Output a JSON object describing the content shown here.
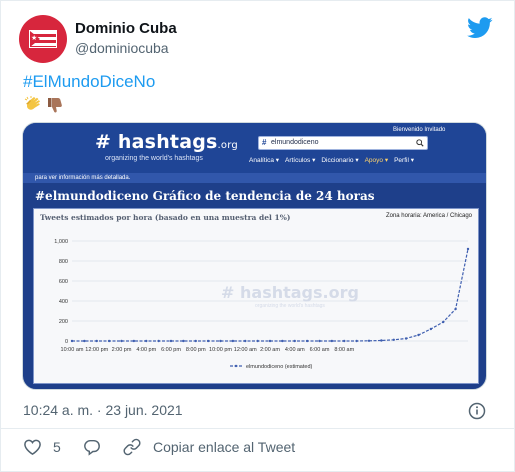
{
  "author": {
    "name": "Dominio Cuba",
    "handle": "@dominiocuba"
  },
  "tweet": {
    "hashtag": "#ElMundoDiceNo",
    "emojis": [
      "clapping-hands-emoji",
      "thumbs-down-emoji"
    ],
    "timestamp": "10:24 a. m. · 23 jun. 2021",
    "like_count": "5",
    "copy_link_label": "Copiar enlace al Tweet"
  },
  "media": {
    "site_logo": "# hashtags",
    "site_logo_suffix": ".org",
    "site_slogan": "organizing the world's hashtags",
    "welcome": "Bienvenido Invitado",
    "search_value": "elmundodiceno",
    "nav": [
      "Analítica ▾",
      "Artículos ▾",
      "Diccionario ▾",
      "Apoyo ▾",
      "Perfil ▾"
    ],
    "info_bar": "para ver información más detallada.",
    "chart_title": "#elmundodiceno Gráfico de tendencia de 24 horas",
    "chart_subtitle": "Tweets estimados por hora (basado en una muestra del 1%)",
    "timezone": "Zona horaria: America / Chicago",
    "watermark": "# hashtags.org",
    "watermark_slogan": "organizing the world's hashtags"
  },
  "chart_data": {
    "type": "line",
    "title": "#elmundodiceno Gráfico de tendencia de 24 horas",
    "subtitle": "Tweets estimados por hora (basado en una muestra del 1%)",
    "xlabel": "",
    "ylabel": "",
    "x_tick_labels": [
      "10:00 am",
      "12:00 pm",
      "2:00 pm",
      "4:00 pm",
      "6:00 pm",
      "8:00 pm",
      "10:00 pm",
      "12:00 am",
      "2:00 am",
      "4:00 am",
      "6:00 am",
      "8:00 am"
    ],
    "y_tick_labels": [
      "0",
      "200",
      "400",
      "600",
      "800",
      "1,000"
    ],
    "ylim": [
      0,
      1000
    ],
    "grid": true,
    "legend": "bottom",
    "series": [
      {
        "name": "elmundodiceno (estimated)",
        "color": "#3f5fb0",
        "values": [
          0,
          0,
          0,
          0,
          0,
          0,
          0,
          0,
          0,
          0,
          0,
          0,
          0,
          0,
          0,
          0,
          0,
          0,
          0,
          0,
          0,
          0,
          0,
          0,
          2,
          5,
          12,
          25,
          60,
          120,
          190,
          320,
          920
        ]
      }
    ]
  }
}
